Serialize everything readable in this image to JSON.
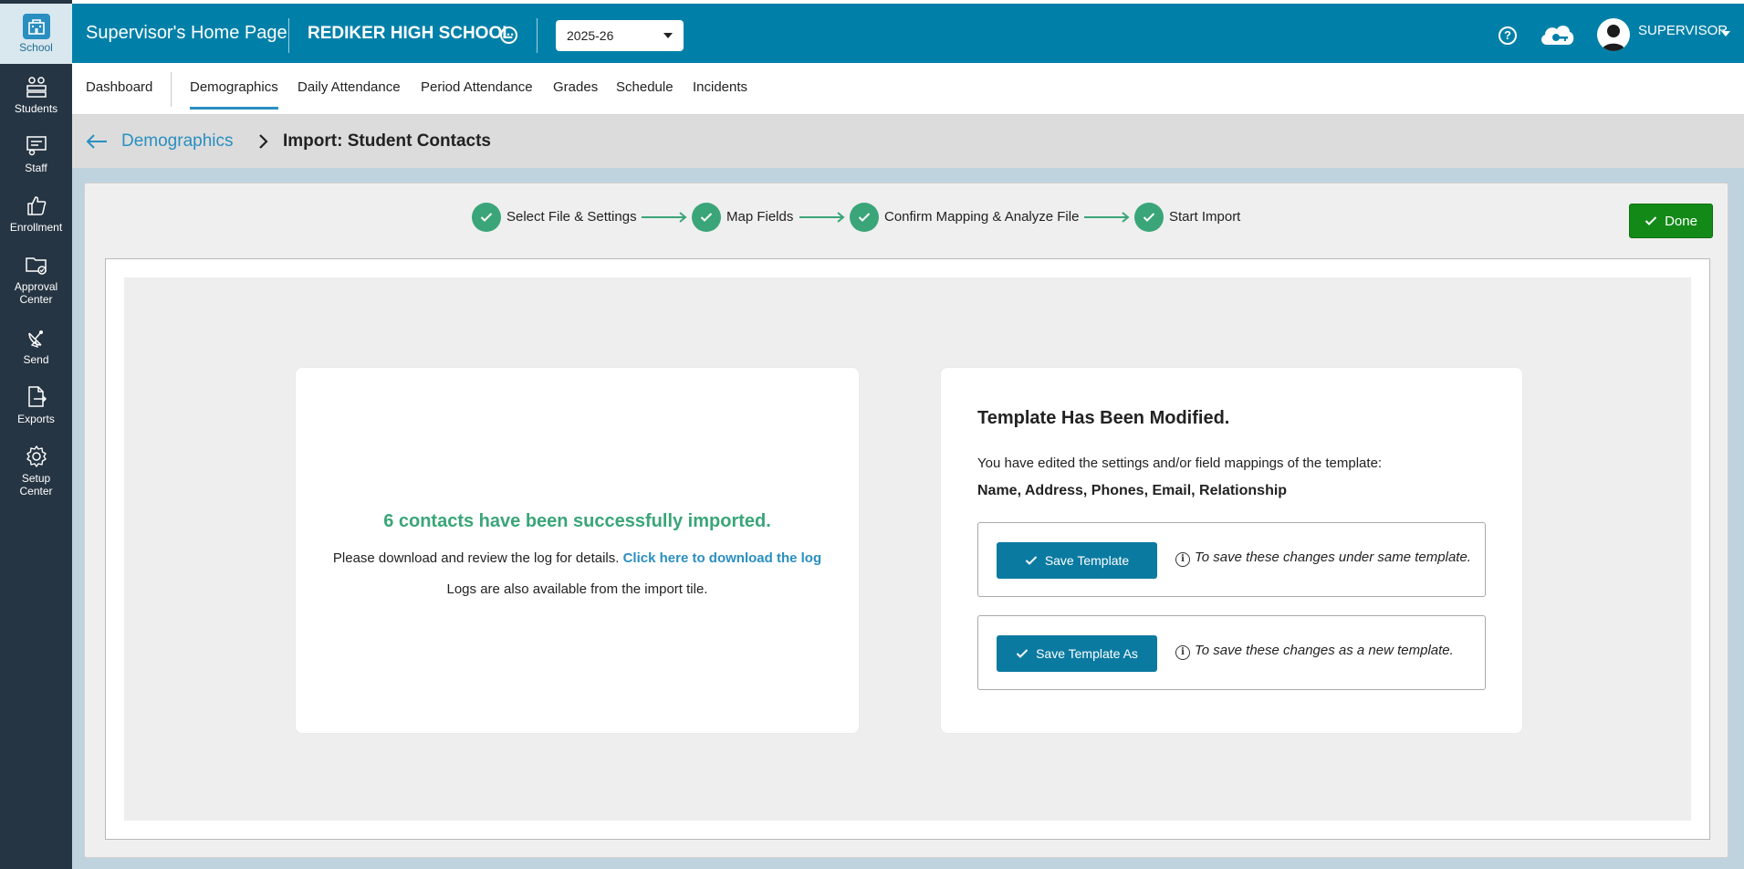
{
  "sidebar": {
    "items": [
      {
        "label": "School"
      },
      {
        "label": "Students"
      },
      {
        "label": "Staff"
      },
      {
        "label": "Enrollment"
      },
      {
        "label": "Approval Center"
      },
      {
        "label": "Send"
      },
      {
        "label": "Exports"
      },
      {
        "label": "Setup Center"
      }
    ]
  },
  "header": {
    "app_title": "Supervisor's Home Page",
    "school_name": "REDIKER HIGH SCHOOL",
    "year": "2025-26",
    "user_name": "SUPERVISOR",
    "accent_color": "#0080a8"
  },
  "nav": {
    "tabs": [
      {
        "label": "Dashboard"
      },
      {
        "label": "Demographics",
        "active": true
      },
      {
        "label": "Daily Attendance"
      },
      {
        "label": "Period Attendance"
      },
      {
        "label": "Grades"
      },
      {
        "label": "Schedule"
      },
      {
        "label": "Incidents"
      }
    ]
  },
  "breadcrumb": {
    "parent": "Demographics",
    "current": "Import: Student Contacts"
  },
  "steps": [
    {
      "label": "Select File & Settings",
      "complete": true
    },
    {
      "label": "Map Fields",
      "complete": true
    },
    {
      "label": "Confirm Mapping & Analyze File",
      "complete": true
    },
    {
      "label": "Start Import",
      "complete": true
    }
  ],
  "done_label": "Done",
  "result": {
    "success": "6 contacts have been successfully imported.",
    "review_prefix": "Please download and review the log for details.",
    "review_link": "Click here to download the log",
    "logs_note": "Logs are also available from the import tile."
  },
  "template": {
    "title": "Template Has Been Modified.",
    "description": "You have edited the settings and/or field mappings of the template:",
    "fields": "Name, Address, Phones, Email, Relationship",
    "save_label": "Save Template",
    "save_hint": "To save these changes under same template.",
    "save_as_label": "Save Template As",
    "save_as_hint": "To save these changes as a new template."
  }
}
